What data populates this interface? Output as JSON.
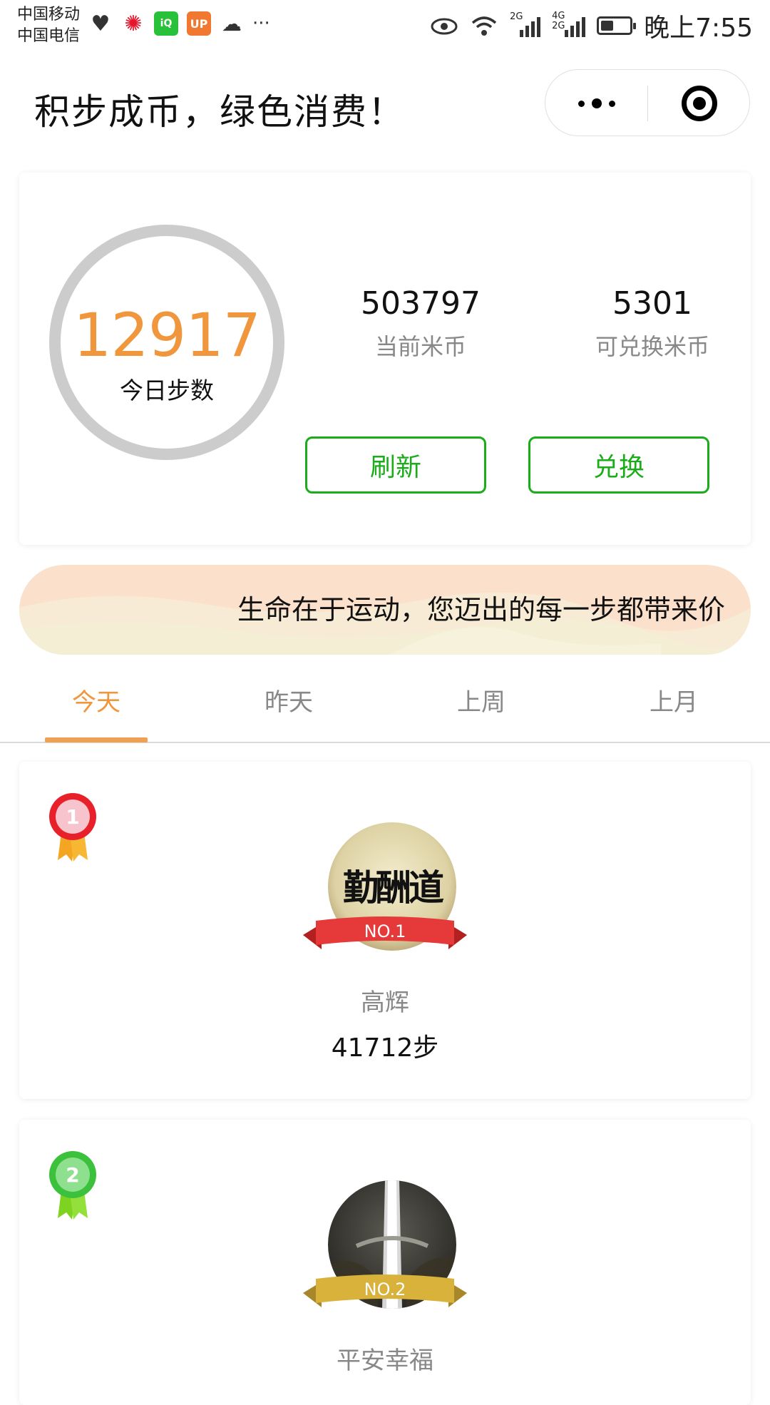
{
  "status_bar": {
    "carrier_1": "中国移动",
    "carrier_2": "中国电信",
    "more_dots": "···",
    "network_1": "2G",
    "network_2": "4G",
    "network_3": "2G",
    "time": "晚上7:55",
    "battery_level": 0.45
  },
  "nav": {
    "title": "积步成币，绿色消费！"
  },
  "stats": {
    "today_steps": "12917",
    "today_steps_label": "今日步数",
    "current_coins": "503797",
    "current_coins_label": "当前米币",
    "exchangeable_coins": "5301",
    "exchangeable_coins_label": "可兑换米币",
    "refresh_label": "刷新",
    "exchange_label": "兑换"
  },
  "banner": {
    "text": "生命在于运动，您迈出的每一步都带来价"
  },
  "tabs": [
    {
      "label": "今天",
      "active": true
    },
    {
      "label": "昨天",
      "active": false
    },
    {
      "label": "上周",
      "active": false
    },
    {
      "label": "上月",
      "active": false
    }
  ],
  "ranking": [
    {
      "rank": "1",
      "badge": "NO.1",
      "name": "高辉",
      "steps": "41712步",
      "avatar_text": "勤酬道",
      "medal_color": "#e8202a",
      "ribbon_color": "#e63a3a"
    },
    {
      "rank": "2",
      "badge": "NO.2",
      "name": "平安幸福",
      "medal_color": "#3bc13b",
      "ribbon_color": "#d9b23c"
    }
  ],
  "colors": {
    "accent_orange": "#f0963c",
    "button_green": "#1aad19",
    "ring_gray": "#cccccc"
  }
}
